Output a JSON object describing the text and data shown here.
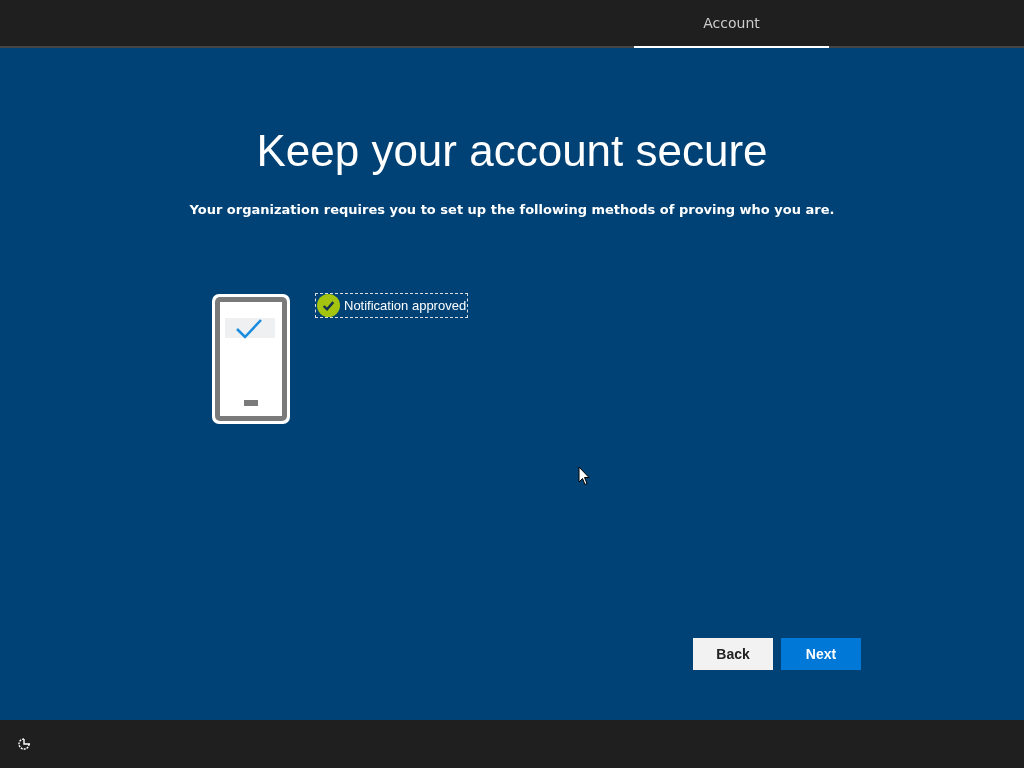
{
  "tabs": [
    {
      "label": "Account",
      "selected": true
    }
  ],
  "title": "Keep your account secure",
  "subtitle": "Your organization requires you to set up the following methods of proving who you are.",
  "method": {
    "status": "Notification approved",
    "approved": true,
    "focused": true
  },
  "buttons": [
    {
      "label": "Back",
      "kind": "secondary"
    },
    {
      "label": "Next",
      "kind": "primary"
    }
  ]
}
